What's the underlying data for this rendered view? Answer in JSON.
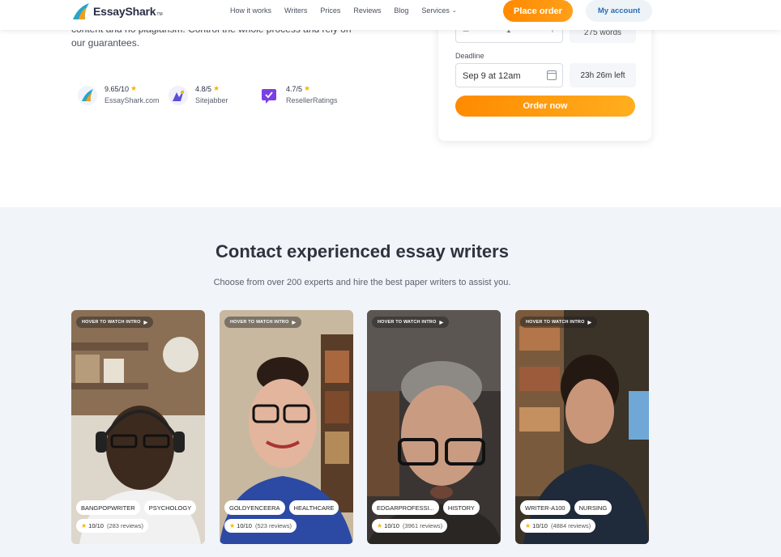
{
  "header": {
    "logo_text": "EssayShark",
    "logo_tm": "TM",
    "nav": [
      "How it works",
      "Writers",
      "Prices",
      "Reviews",
      "Blog",
      "Services"
    ],
    "place_order": "Place order",
    "my_account": "My account"
  },
  "hero": {
    "text": "content and no plagiarism. Control the whole process and rely on our guarantees."
  },
  "ratings": [
    {
      "score": "9.65/10",
      "source": "EssayShark.com"
    },
    {
      "score": "4.8/5",
      "source": "Sitejabber"
    },
    {
      "score": "4.7/5",
      "source": "ResellerRatings"
    }
  ],
  "order_form": {
    "quantity": "1",
    "words": "275 words",
    "deadline_label": "Deadline",
    "deadline_value": "Sep 9 at 12am",
    "time_left": "23h 26m left",
    "order_button": "Order now"
  },
  "writers_section": {
    "title": "Contact experienced essay writers",
    "subtitle": "Choose from over 200 experts and hire the best paper writers to assist you.",
    "hover_label": "HOVER TO WATCH INTRO",
    "writers": [
      {
        "name": "BANGPOPWRITER",
        "subject": "PSYCHOLOGY",
        "rating": "10/10",
        "reviews": "(283 reviews)"
      },
      {
        "name": "GOLDYENCEERA",
        "subject": "HEALTHCARE",
        "rating": "10/10",
        "reviews": "(523 reviews)"
      },
      {
        "name": "EDGARPROFESSI...",
        "subject": "HISTORY",
        "rating": "10/10",
        "reviews": "(3961 reviews)"
      },
      {
        "name": "WRITER-A100",
        "subject": "NURSING",
        "rating": "10/10",
        "reviews": "(4884 reviews)"
      }
    ]
  },
  "colors": {
    "accent_orange": "#ff8a00",
    "account_blue": "#2b6cb0",
    "section_bg": "#f1f4f8",
    "star": "#f7b500"
  }
}
